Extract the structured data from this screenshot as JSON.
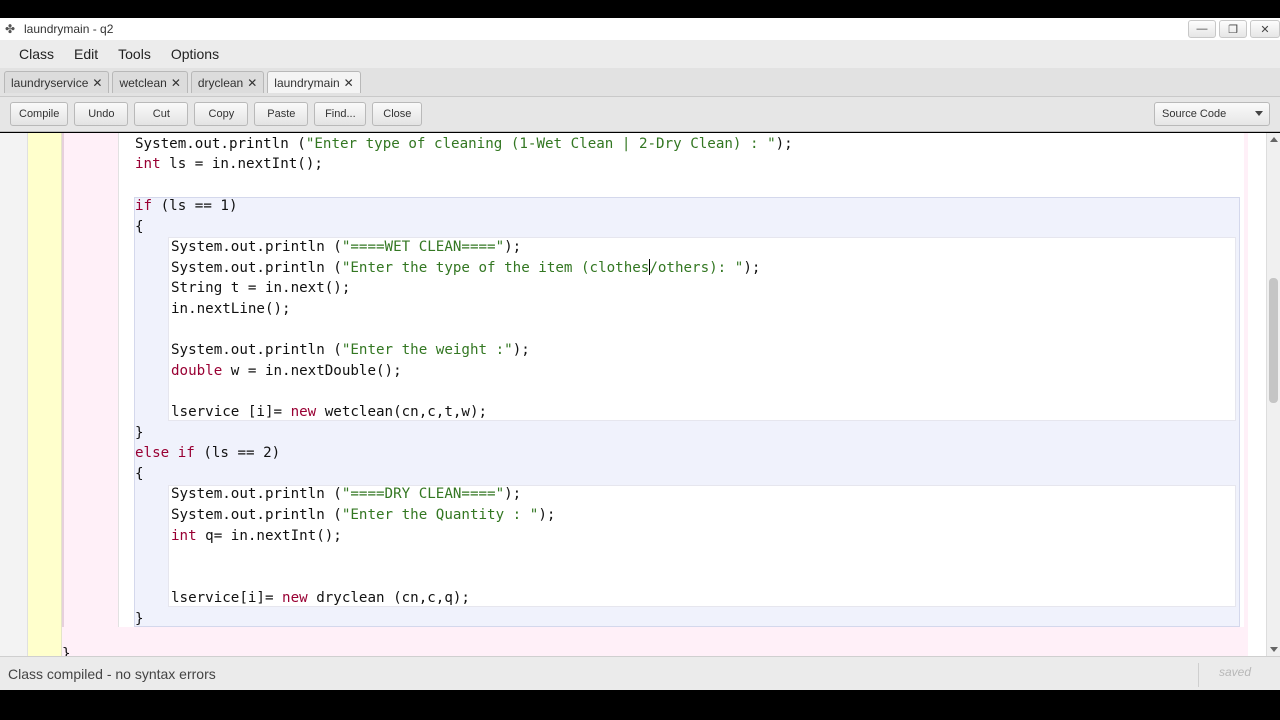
{
  "window": {
    "title": "laundrymain - q2",
    "icon": "bluej-bird-icon"
  },
  "menu": [
    "Class",
    "Edit",
    "Tools",
    "Options"
  ],
  "tabs": [
    {
      "label": "laundryservice",
      "active": false
    },
    {
      "label": "wetclean",
      "active": false
    },
    {
      "label": "dryclean",
      "active": false
    },
    {
      "label": "laundrymain",
      "active": true
    }
  ],
  "toolbar": {
    "compile": "Compile",
    "undo": "Undo",
    "cut": "Cut",
    "copy": "Copy",
    "paste": "Paste",
    "find": "Find...",
    "close": "Close",
    "view_select": "Source Code"
  },
  "code": {
    "l1a": "System.out.println (",
    "l1s": "\"Enter type of cleaning (1-Wet Clean | 2-Dry Clean) : \"",
    "l1b": ");",
    "l2k": "int",
    "l2b": " ls = in.nextInt();",
    "l3k": "if",
    "l3b": " (ls == 1)",
    "l4": "{",
    "l5a": "System.out.println (",
    "l5s": "\"====WET CLEAN====\"",
    "l5b": ");",
    "l6a": "System.out.println (",
    "l6s1": "\"Enter the type of the item (clothes",
    "l6s2": "/others): \"",
    "l6b": ");",
    "l7": "String t = in.next();",
    "l8": "in.nextLine();",
    "l9a": "System.out.println (",
    "l9s": "\"Enter the weight :\"",
    "l9b": ");",
    "l10k": "double",
    "l10b": " w = in.nextDouble();",
    "l11a": "lservice [i]= ",
    "l11k": "new",
    "l11b": " wetclean(cn,c,t,w);",
    "l12": "}",
    "l13k1": "else",
    "l13k2": "if",
    "l13b": " (ls == 2)",
    "l14": "{",
    "l15a": "System.out.println (",
    "l15s": "\"====DRY CLEAN====\"",
    "l15b": ");",
    "l16a": "System.out.println (",
    "l16s": "\"Enter the Quantity : \"",
    "l16b": ");",
    "l17k": "int",
    "l17b": " q= in.nextInt();",
    "l18a": "lservice[i]= ",
    "l18k": "new",
    "l18b": " dryclean (cn,c,q);",
    "l19": "}",
    "l20": "}"
  },
  "status": {
    "message": "Class compiled - no syntax errors",
    "saved": "saved"
  },
  "colors": {
    "keyword": "#990033",
    "string": "#337722",
    "gutter": "#ffffcc",
    "method_scope": "#fff0f8",
    "block_scope": "#f0f2fc"
  }
}
